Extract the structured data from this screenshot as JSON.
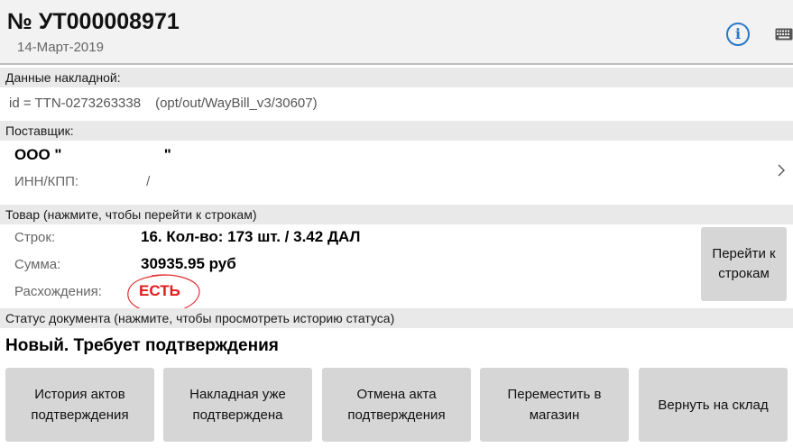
{
  "header": {
    "doc_number": "№ УТ000008971",
    "doc_date": "14-Март-2019",
    "info_icon_glyph": "i",
    "info_icon": "info-icon",
    "keyboard_icon": "keyboard-icon"
  },
  "waybill": {
    "section_title": "Данные накладной:",
    "id_text": "id = TTN-0273263338",
    "path_text": "(opt/out/WayBill_v3/30607)"
  },
  "supplier": {
    "section_title": "Поставщик:",
    "name": "ООО \"                        \"",
    "inn_kpp": "ИНН/КПП:                  /",
    "chevron_icon": "chevron-right-icon"
  },
  "goods": {
    "section_title": "Товар (нажмите, чтобы перейти к строкам)",
    "rows_label": "Строк:",
    "rows_value": "16. Кол-во: 173 шт. / 3.42 ДАЛ",
    "sum_label": "Сумма:",
    "sum_value": "30935.95 руб",
    "diff_label": "Расхождения:",
    "diff_value": "ЕСТЬ",
    "goto_button": "Перейти к строкам"
  },
  "status": {
    "section_title": "Статус документа (нажмите, чтобы просмотреть историю статуса)",
    "value": "Новый. Требует подтверждения"
  },
  "actions": [
    {
      "label": "История актов подтверждения"
    },
    {
      "label": "Накладная уже подтверждена"
    },
    {
      "label": "Отмена акта подтверждения"
    },
    {
      "label": "Переместить в магазин"
    },
    {
      "label": "Вернуть на склад"
    }
  ],
  "colors": {
    "accent_blue": "#2a78c8",
    "warning_red": "#e21b1b",
    "button_gray": "#d6d6d6",
    "section_gray": "#e9e9e9"
  }
}
